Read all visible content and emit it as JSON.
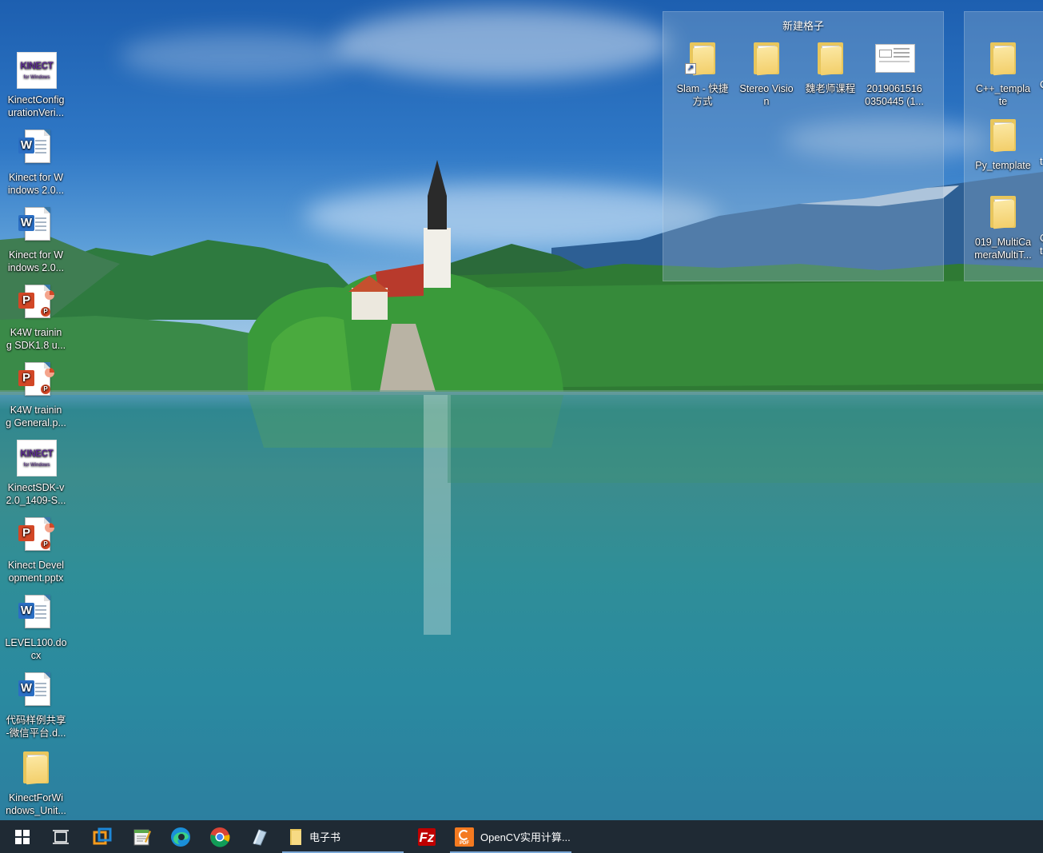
{
  "desktop": {
    "left_icons": [
      {
        "label": "KinectConfigurationVeri...",
        "line1": "KinectConfig",
        "line2": "urationVeri...",
        "icon": "kinect-icon"
      },
      {
        "label": "Kinect for Windows 2.0...",
        "line1": "Kinect for W",
        "line2": "indows 2.0...",
        "icon": "word-doc-icon"
      },
      {
        "label": "Kinect for Windows 2.0...",
        "line1": "Kinect for W",
        "line2": "indows 2.0...",
        "icon": "word-doc-icon"
      },
      {
        "label": "K4W training SDK1.8 u...",
        "line1": "K4W trainin",
        "line2": "g SDK1.8 u...",
        "icon": "powerpoint-icon"
      },
      {
        "label": "K4W training General.p...",
        "line1": "K4W trainin",
        "line2": "g General.p...",
        "icon": "powerpoint-icon"
      },
      {
        "label": "KinectSDK-v2.0_1409-S...",
        "line1": "KinectSDK-v",
        "line2": "2.0_1409-S...",
        "icon": "kinect-icon"
      },
      {
        "label": "Kinect Development.pptx",
        "line1": "Kinect Devel",
        "line2": "opment.pptx",
        "icon": "powerpoint-icon"
      },
      {
        "label": "LEVEL100.docx",
        "line1": "LEVEL100.do",
        "line2": "cx",
        "icon": "word-doc-icon"
      },
      {
        "label": "代码样例共享-微信平台.d...",
        "line1": "代码样例共享",
        "line2": "-微信平台.d...",
        "icon": "word-doc-icon"
      },
      {
        "label": "KinectForWindows_Unit...",
        "line1": "KinectForWi",
        "line2": "ndows_Unit...",
        "icon": "folder-icon"
      }
    ],
    "fence1": {
      "title": "新建格子",
      "items": [
        {
          "line1": "Slam - 快捷",
          "line2": "方式",
          "icon": "folder-shortcut-icon"
        },
        {
          "line1": "Stereo Visio",
          "line2": "n",
          "icon": "folder-icon"
        },
        {
          "line1": "魏老师课程",
          "line2": "",
          "icon": "folder-icon"
        },
        {
          "line1": "2019061516",
          "line2": "0350445 (1...",
          "icon": "image-file-icon"
        }
      ]
    },
    "fence2": {
      "items": [
        {
          "line1": "C++_templa",
          "line2": "te",
          "icon": "folder-icon"
        },
        {
          "line1": "Py_template",
          "line2": "",
          "icon": "folder-icon"
        },
        {
          "line1": "019_MultiCa",
          "line2": "meraMultiT...",
          "icon": "folder-icon"
        }
      ]
    }
  },
  "taskbar": {
    "pinned": [
      {
        "name": "start-button",
        "icon": "windows-logo-icon"
      },
      {
        "name": "task-view-button",
        "icon": "task-view-icon"
      },
      {
        "name": "vmware-button",
        "icon": "vmware-icon"
      },
      {
        "name": "notepad-button",
        "icon": "notepad-icon"
      },
      {
        "name": "edge-button",
        "icon": "edge-icon"
      },
      {
        "name": "chrome-button",
        "icon": "chrome-icon"
      },
      {
        "name": "app-button",
        "icon": "app-icon"
      }
    ],
    "explorer_label": "电子书",
    "filezilla_icon": "filezilla-icon",
    "pdf_label": "OpenCV实用计算...",
    "pdf_icon_text": "PDF",
    "accent_color": "#7aa7d6"
  }
}
